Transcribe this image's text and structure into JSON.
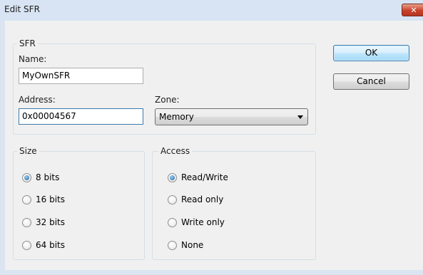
{
  "window": {
    "title": "Edit SFR",
    "close_label": "✕"
  },
  "sfr_group": {
    "legend": "SFR",
    "name_label": "Name:",
    "name_value": "MyOwnSFR",
    "address_label": "Address:",
    "address_value": "0x00004567",
    "zone_label": "Zone:",
    "zone_value": "Memory"
  },
  "size_group": {
    "legend": "Size",
    "options": [
      "8 bits",
      "16 bits",
      "32 bits",
      "64 bits"
    ],
    "selected": "8 bits"
  },
  "access_group": {
    "legend": "Access",
    "options": [
      "Read/Write",
      "Read only",
      "Write only",
      "None"
    ],
    "selected": "Read/Write"
  },
  "buttons": {
    "ok": "OK",
    "cancel": "Cancel"
  },
  "colors": {
    "titlebar": "#d8e4f3",
    "client": "#f0f0f0",
    "close_button": "#c8412a",
    "default_button_border": "#3c7fb1"
  }
}
